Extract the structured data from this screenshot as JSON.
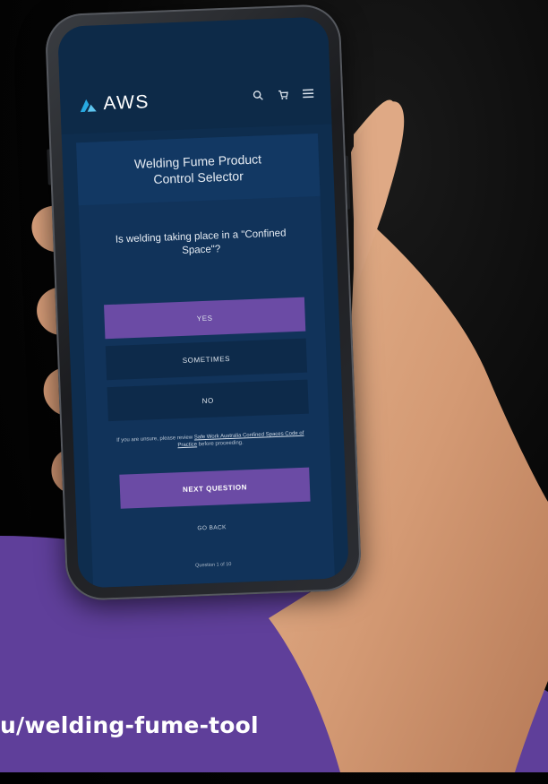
{
  "url_banner": "u/welding-fume-tool",
  "app": {
    "logo_text": "AWS",
    "icons": [
      "search-icon",
      "cart-icon",
      "menu-icon"
    ]
  },
  "card": {
    "title": "Welding Fume Product Control Selector",
    "question": "Is welding taking place in a \"Confined Space\"?",
    "options": [
      "YES",
      "SOMETIMES",
      "NO"
    ],
    "note_prefix": "If you are unsure, please review ",
    "note_link": "Safe Work Australia Confined Spaces Code of Practice",
    "note_suffix": " before proceeding.",
    "next_label": "NEXT QUESTION",
    "back_label": "GO BACK",
    "progress_label": "Question 1 of 10"
  },
  "colors": {
    "background": "#000000",
    "purple_band": "#5f3f9a",
    "screen_bg": "#0e2d4e",
    "card_bg": "#11335a",
    "accent_button": "#6b4ba5",
    "skin": "#d9a07c"
  }
}
